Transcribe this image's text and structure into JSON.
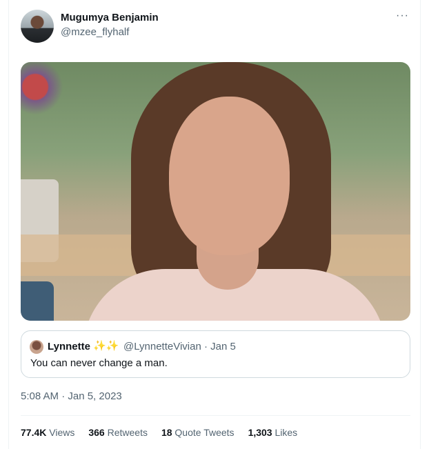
{
  "author": {
    "name": "Mugumya Benjamin",
    "handle": "@mzee_flyhalf"
  },
  "quoted_tweet": {
    "name": "Lynnette",
    "emoji": "✨✨",
    "handle": "@LynnetteVivian · Jan 5",
    "text": "You can never change a man."
  },
  "timestamp": "5:08 AM · Jan 5, 2023",
  "stats": {
    "views_count": "77.4K",
    "views_label": "Views",
    "retweets_count": "366",
    "retweets_label": "Retweets",
    "quotes_count": "18",
    "quotes_label": "Quote Tweets",
    "likes_count": "1,303",
    "likes_label": "Likes"
  },
  "icons": {
    "more": "more-horizontal-icon"
  },
  "colors": {
    "text_primary": "#0f1419",
    "text_secondary": "#536471",
    "border": "#cfd9de"
  }
}
